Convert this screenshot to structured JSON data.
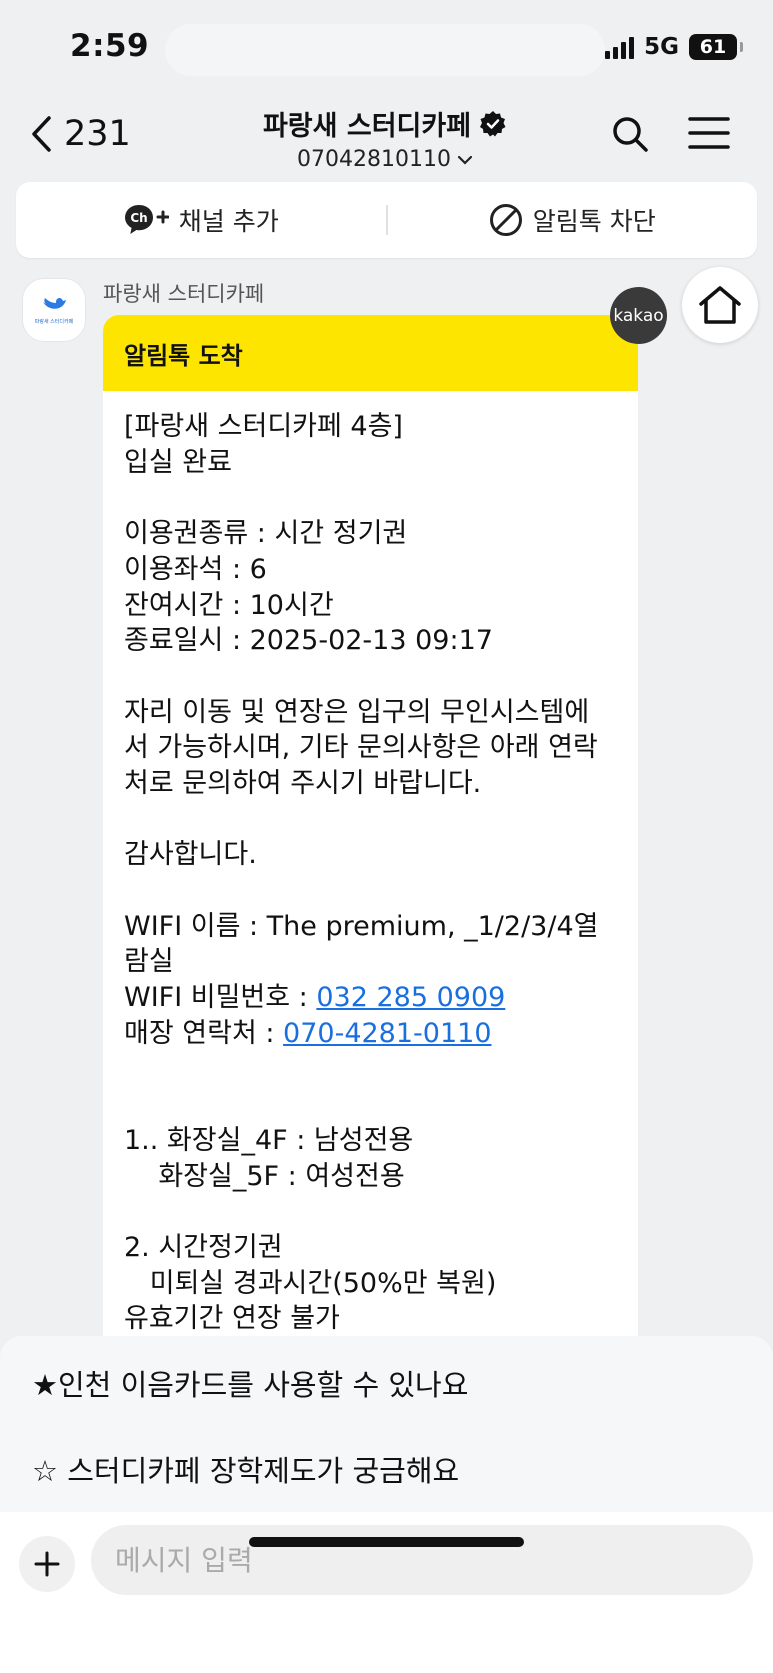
{
  "status": {
    "time": "2:59",
    "network": "5G",
    "battery": "61"
  },
  "header": {
    "back_count": "231",
    "title": "파랑새 스터디카페",
    "phone": "07042810110"
  },
  "actions": {
    "add_channel": "채널 추가",
    "block": "알림톡 차단"
  },
  "sender": {
    "name": "파랑새 스터디카페",
    "avatar_text": "파랑새 스터디카페"
  },
  "message": {
    "heading": "알림톡 도착",
    "lines": [
      "[파랑새 스터디카페 4층]",
      "입실 완료",
      "",
      "이용권종류 : 시간 정기권",
      "이용좌석 : 6",
      "잔여시간 : 10시간",
      "종료일시 : 2025-02-13 09:17",
      "",
      "자리 이동 및 연장은 입구의 무인시스템에",
      "서 가능하시며, 기타 문의사항은 아래 연락",
      "처로 문의하여 주시기 바랍니다.",
      "",
      "감사합니다.",
      "",
      "WIFI 이름 : The premium, _1/2/3/4열",
      "람실"
    ],
    "wifi_pw_label": "WIFI 비밀번호 : ",
    "wifi_pw": "032 285 0909",
    "store_contact_label": "매장 연락처 : ",
    "store_contact": "070-4281-0110",
    "lines2": [
      "",
      "",
      "1.. 화장실_4F : 남성전용",
      "    화장실_5F : 여성전용",
      "",
      "2. 시간정기권",
      "   미퇴실 경과시간(50%만 복원)",
      "유효기간 연장 불가"
    ]
  },
  "kakao_badge": "kakao",
  "quick_replies": [
    "★인천 이음카드를 사용할 수 있나요",
    "☆ 스터디카페 장학제도가 궁금해요"
  ],
  "input": {
    "placeholder": "메시지 입력"
  },
  "icons": {
    "back": "chevron-left-icon",
    "verified": "verified-badge-icon",
    "dropdown": "chevron-down-icon",
    "search": "search-icon",
    "menu": "hamburger-menu-icon",
    "channel": "channel-add-icon",
    "block": "block-icon",
    "home": "home-icon",
    "plus": "plus-icon"
  },
  "colors": {
    "accent_yellow": "#fee500",
    "link_blue": "#1a6fe0",
    "background": "#eef0f2"
  }
}
